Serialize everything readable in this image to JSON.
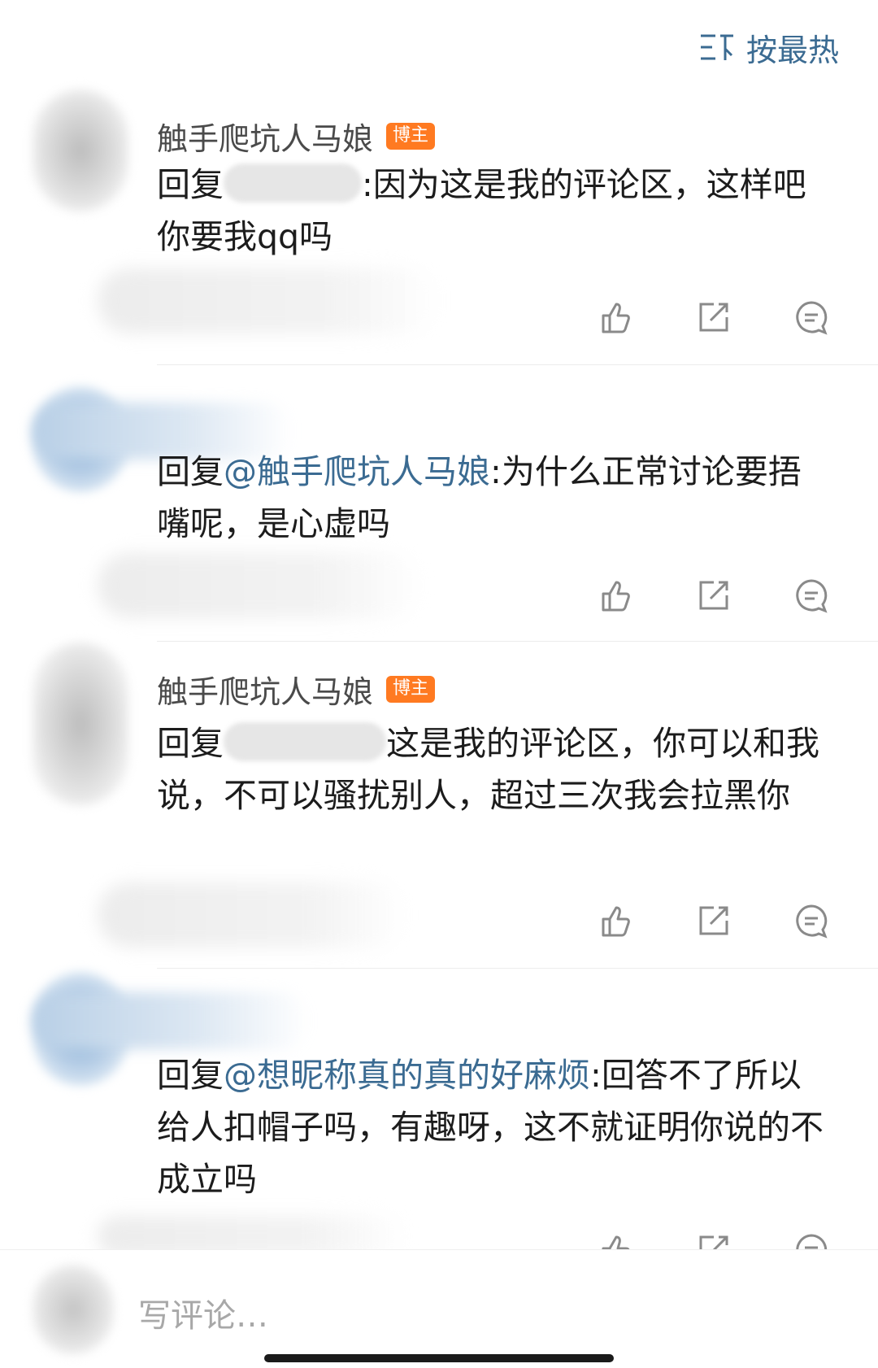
{
  "sort": {
    "label": "按最热",
    "icon": "sort-icon"
  },
  "comments": [
    {
      "author": "触手爬坑人马娘",
      "badge": "博主",
      "reply_prefix": "回复",
      "text": ":因为这是我的评论区，这样吧你要我qq吗"
    },
    {
      "reply_prefix": "回复",
      "mention": "@触手爬坑人马娘",
      "text": ":为什么正常讨论要捂嘴呢，是心虚吗"
    },
    {
      "author": "触手爬坑人马娘",
      "badge": "博主",
      "reply_prefix": "回复",
      "text": "这是我的评论区，你可以和我说，不可以骚扰别人，超过三次我会拉黑你"
    },
    {
      "reply_prefix": "回复",
      "mention": "@想昵称真的真的好麻烦",
      "text": ":回答不了所以给人扣帽子吗，有趣呀，这不就证明你说的不成立吗"
    }
  ],
  "actions": [
    "like-icon",
    "share-icon",
    "comment-icon"
  ],
  "compose": {
    "placeholder": "写评论…"
  },
  "colors": {
    "accent": "#3b6b92",
    "badge": "#ff7a21"
  }
}
